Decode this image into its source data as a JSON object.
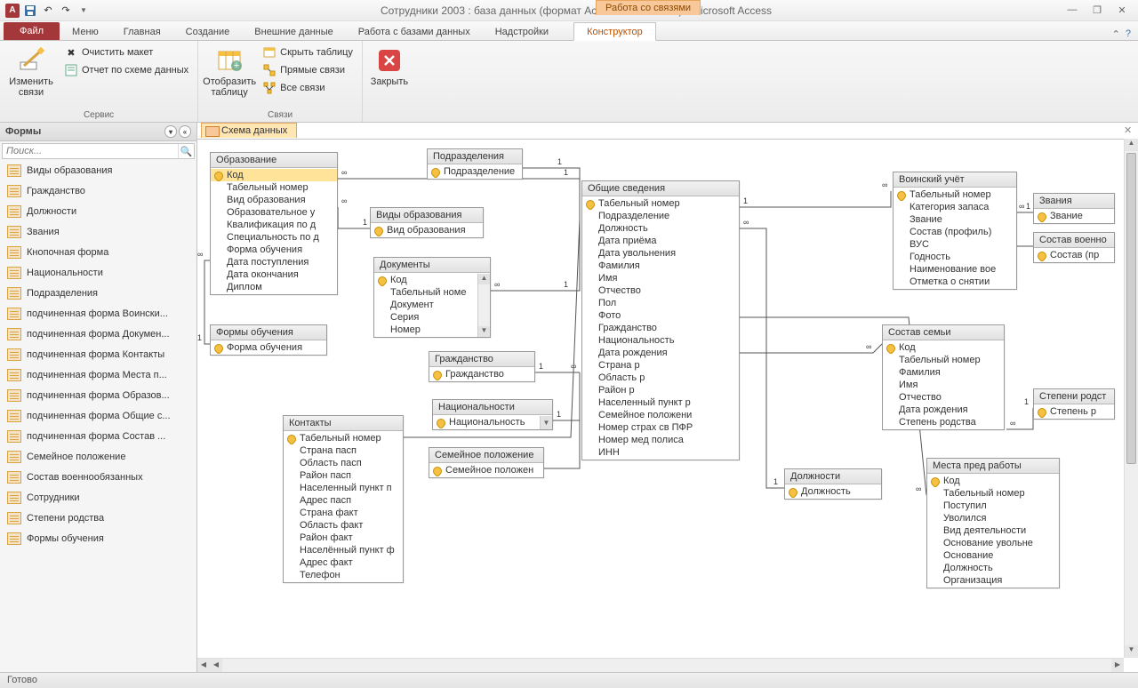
{
  "title": "Сотрудники 2003 : база данных (формат Access 2002 - 2003)  -  Microsoft Access",
  "context_group": "Работа со связями",
  "ribbon": {
    "file": "Файл",
    "tabs": [
      "Меню",
      "Главная",
      "Создание",
      "Внешние данные",
      "Работа с базами данных",
      "Надстройки"
    ],
    "context_tab": "Конструктор",
    "groups": {
      "service": {
        "label": "Сервис",
        "edit_rel": "Изменить связи",
        "clear_layout": "Очистить макет",
        "rel_report": "Отчет по схеме данных"
      },
      "show_table": {
        "label": "Отобразить таблицу"
      },
      "links": {
        "label": "Связи",
        "hide_table": "Скрыть таблицу",
        "direct": "Прямые связи",
        "all": "Все связи"
      },
      "close": "Закрыть"
    }
  },
  "nav": {
    "header": "Формы",
    "search_placeholder": "Поиск...",
    "items": [
      "Виды образования",
      "Гражданство",
      "Должности",
      "Звания",
      "Кнопочная форма",
      "Национальности",
      "Подразделения",
      "подчиненная форма Воински...",
      "подчиненная форма Докумен...",
      "подчиненная форма Контакты",
      "подчиненная форма Места п...",
      "подчиненная форма Образов...",
      "подчиненная форма Общие с...",
      "подчиненная форма Состав ...",
      "Семейное положение",
      "Состав военнообязанных",
      "Сотрудники",
      "Степени родства",
      "Формы обучения"
    ]
  },
  "doc_tab": "Схема данных",
  "status": "Готово",
  "tables": {
    "obrazovanie": {
      "title": "Образование",
      "fields": [
        "Код",
        "Табельный номер",
        "Вид образования",
        "Образовательное у",
        "Квалификация по д",
        "Специальность по д",
        "Форма обучения",
        "Дата поступления",
        "Дата окончания",
        "Диплом"
      ],
      "keys": [
        0
      ]
    },
    "podrazdel": {
      "title": "Подразделения",
      "fields": [
        "Подразделение"
      ],
      "keys": [
        0
      ]
    },
    "vidy_obr": {
      "title": "Виды образования",
      "fields": [
        "Вид образования"
      ],
      "keys": [
        0
      ]
    },
    "documenty": {
      "title": "Документы",
      "fields": [
        "Код",
        "Табельный номе",
        "Документ",
        "Серия",
        "Номер"
      ],
      "keys": [
        0
      ]
    },
    "formy_ob": {
      "title": "Формы обучения",
      "fields": [
        "Форма обучения"
      ],
      "keys": [
        0
      ]
    },
    "grazhd": {
      "title": "Гражданство",
      "fields": [
        "Гражданство"
      ],
      "keys": [
        0
      ]
    },
    "natsional": {
      "title": "Национальности",
      "fields": [
        "Национальность"
      ],
      "keys": [
        0
      ]
    },
    "semeynoe": {
      "title": "Семейное положение",
      "fields": [
        "Семейное положен"
      ],
      "keys": [
        0
      ]
    },
    "kontakty": {
      "title": "Контакты",
      "fields": [
        "Табельный номер",
        "Страна пасп",
        "Область пасп",
        "Район пасп",
        "Населенный пункт п",
        "Адрес пасп",
        "Страна факт",
        "Область факт",
        "Район факт",
        "Населённый пункт ф",
        "Адрес факт",
        "Телефон"
      ],
      "keys": [
        0
      ]
    },
    "obschie": {
      "title": "Общие сведения",
      "fields": [
        "Табельный номер",
        "Подразделение",
        "Должность",
        "Дата приёма",
        "Дата увольнения",
        "Фамилия",
        "Имя",
        "Отчество",
        "Пол",
        "Фото",
        "Гражданство",
        "Национальность",
        "Дата рождения",
        "Страна р",
        "Область р",
        "Район р",
        "Населенный пункт р",
        "Семейное положени",
        "Номер страх св ПФР",
        "Номер мед полиса",
        "ИНН"
      ],
      "keys": [
        0
      ]
    },
    "dolzhnosti": {
      "title": "Должности",
      "fields": [
        "Должность"
      ],
      "keys": [
        0
      ]
    },
    "voinskiy": {
      "title": "Воинский учёт",
      "fields": [
        "Табельный номер",
        "Категория запаса",
        "Звание",
        "Состав (профиль)",
        "ВУС",
        "Годность",
        "Наименование вое",
        "Отметка о снятии"
      ],
      "keys": [
        0
      ]
    },
    "zvaniya": {
      "title": "Звания",
      "fields": [
        "Звание"
      ],
      "keys": [
        0
      ]
    },
    "sostav_vo": {
      "title": "Состав военно",
      "fields": [
        "Состав (пр"
      ],
      "keys": [
        0
      ]
    },
    "sostav_sem": {
      "title": "Состав семьи",
      "fields": [
        "Код",
        "Табельный номер",
        "Фамилия",
        "Имя",
        "Отчество",
        "Дата рождения",
        "Степень родства"
      ],
      "keys": [
        0
      ]
    },
    "stepeni": {
      "title": "Степени родст",
      "fields": [
        "Степень р"
      ],
      "keys": [
        0
      ]
    },
    "mesta_pred": {
      "title": "Места пред работы",
      "fields": [
        "Код",
        "Табельный номер",
        "Поступил",
        "Уволился",
        "Вид деятельности",
        "Основание увольне",
        "Основание",
        "Должность",
        "Организация"
      ],
      "keys": [
        0
      ]
    }
  }
}
